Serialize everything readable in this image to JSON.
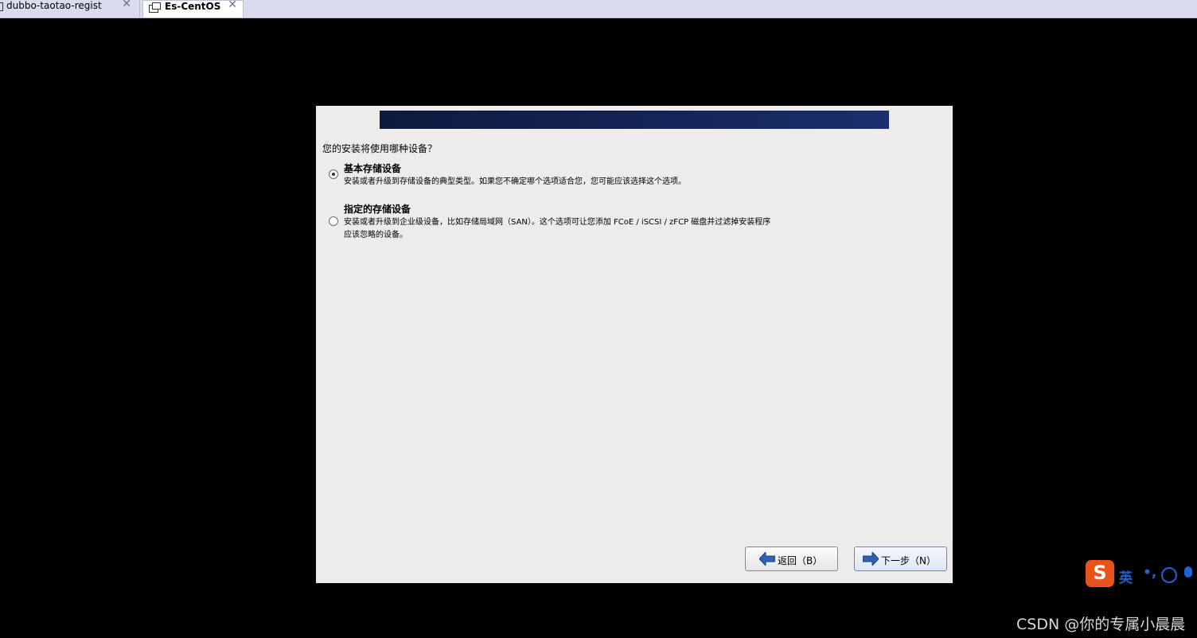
{
  "tabs": [
    {
      "label": "dubbo-taotao-regist",
      "close": "✕",
      "active": false
    },
    {
      "label": "Es-CentOS",
      "close": "✕",
      "active": true
    }
  ],
  "installer": {
    "question": "您的安装将使用哪种设备？",
    "options": [
      {
        "title": "基本存储设备",
        "description": "安装或者升级到存储设备的典型类型。如果您不确定哪个选项适合您，您可能应该选择这个选项。",
        "selected": true
      },
      {
        "title": "指定的存储设备",
        "description_line1": "安装或者升级到企业级设备，比如存储局域网（SAN）。这个选项可让您添加 FCoE / iSCSI / zFCP 磁盘并过滤掉安装程序",
        "description_line2": "应该忽略的设备。",
        "selected": false
      }
    ],
    "back_button": "返回（B）",
    "next_button": "下一步（N）"
  },
  "ime": {
    "logo": "S",
    "language": "英",
    "punct": "•,",
    "icons": [
      "emoji-icon",
      "mic-icon"
    ]
  },
  "watermark": "CSDN @你的专属小晨晨",
  "colors": {
    "banner": "#142457",
    "installer_bg": "#edeceb",
    "ime_accent": "#1b63d2",
    "ime_logo": "#e8531c"
  }
}
